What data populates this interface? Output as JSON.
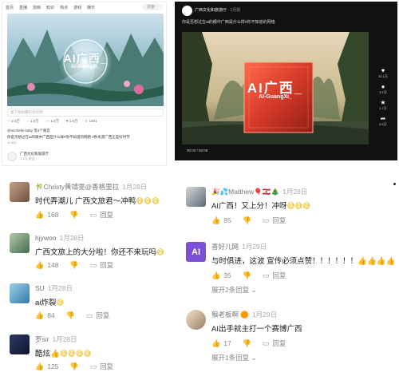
{
  "left": {
    "nav": [
      "首页",
      "直播",
      "放映",
      "知识",
      "热点",
      "游戏",
      "娱乐"
    ],
    "search_placeholder": "搜索",
    "art_title": "AI广西_",
    "art_subtitle": "AI-GuangXi_",
    "comment_placeholder": "留下你的精彩评论吧",
    "stats": [
      "2.3万",
      "1.6万",
      "1.2万",
      "1.6万",
      "1401"
    ],
    "mentions": "@michelle baby  等3个朋友",
    "caption": "你是否想过在ai的眼中广西是什么样#你不知道的网络 #秋冬游广西正是好时节",
    "views": "10.6亿",
    "account_name": "广西文化和旅游厅",
    "account_sub": "1.1万 关注"
  },
  "right": {
    "channel": "广西文化和旅游厅",
    "channel_suffix": "· 1月前",
    "caption": "你是否想过在ai的眼中广西是什么样#你不知道的网络",
    "video_title": "AI广西_",
    "video_subtitle": "AI-GuangXi_",
    "time": "00:02 / 00:09",
    "controls": [
      {
        "icon": "heart-icon",
        "glyph": "♥",
        "count": "32.1万"
      },
      {
        "icon": "comment-icon",
        "glyph": "●",
        "count": "3.7万"
      },
      {
        "icon": "star-icon",
        "glyph": "★",
        "count": "1.7万"
      },
      {
        "icon": "share-icon",
        "glyph": "➦",
        "count": "5.5万"
      }
    ]
  },
  "comments": [
    {
      "name": "🎋Christy黄靖雯@香格里拉",
      "date": "1月28日",
      "text": "时代弄潮儿 广西文旅君～冲鸭",
      "emoji": "😅😅😅",
      "likes": "168",
      "reply": "回复",
      "expand": ""
    },
    {
      "name": "hjywoo",
      "date": "1月28日",
      "text": "广西文旅上的大分啦！你还不来玩吗",
      "emoji": "😅",
      "likes": "148",
      "reply": "回复",
      "expand": ""
    },
    {
      "name": "SU",
      "date": "1月28日",
      "text": "ai炸裂",
      "emoji": "😅",
      "likes": "84",
      "reply": "回复",
      "expand": ""
    },
    {
      "name": "罗sir",
      "date": "1月28日",
      "text": "酷炫",
      "emoji": "👍😅😅😅😅",
      "likes": "125",
      "reply": "回复",
      "expand": ""
    },
    {
      "name": "🎉💦Matthew🎈🇱🇧🎄",
      "date": "1月28日",
      "text": "AI广西！又上分！冲呀",
      "emoji": "😅😅😅",
      "likes": "85",
      "reply": "回复",
      "expand": ""
    },
    {
      "name": "喜好儿网",
      "date": "1月29日",
      "text": "与时俱进，这波 宣传必须点赞！！！！！！",
      "emoji": "👍👍👍👍",
      "likes": "35",
      "reply": "回复",
      "expand": "展开2条回复 ⌄"
    },
    {
      "name": "猴老板啊 🟠",
      "date": "1月29日",
      "text": "AI出手就主打一个赛博广西",
      "emoji": "",
      "likes": "17",
      "reply": "回复",
      "expand": "展开1条回复 ⌄"
    }
  ]
}
